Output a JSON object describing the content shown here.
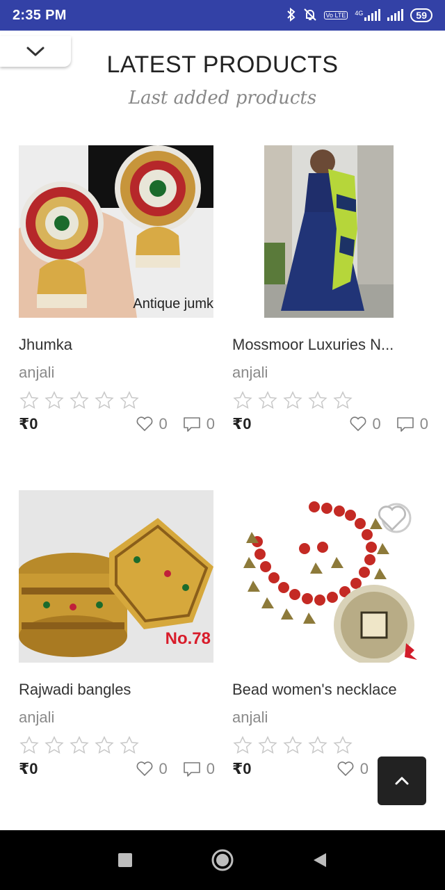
{
  "status_bar": {
    "time": "2:35 PM",
    "network_badge": "Vo LTE",
    "network_type": "4G",
    "battery": "59"
  },
  "header": {
    "title": "LATEST PRODUCTS",
    "subtitle": "Last added products"
  },
  "products": [
    {
      "name": "Jhumka",
      "seller": "anjali",
      "rating": 0,
      "price": "₹0",
      "likes": "0",
      "comments": "0",
      "image_caption": "Antique jumk",
      "image_kind": "gold earrings"
    },
    {
      "name": "Mossmoor Luxuries N...",
      "seller": "anjali",
      "rating": 0,
      "price": "₹0",
      "likes": "0",
      "comments": "0",
      "image_kind": "blue dress with green dupatta"
    },
    {
      "name": "Rajwadi bangles",
      "seller": "anjali",
      "rating": 0,
      "price": "₹0",
      "likes": "0",
      "comments": "0",
      "image_caption": "No.78",
      "image_kind": "gold bangles"
    },
    {
      "name": "Bead women's necklace",
      "seller": "anjali",
      "rating": 0,
      "price": "₹0",
      "likes": "0",
      "image_kind": "red bead necklace"
    }
  ],
  "colors": {
    "status_bar": "#3341a6",
    "nav_bar": "#000000",
    "muted_text": "#8a8a8a",
    "back_to_top": "#222222"
  },
  "icons": {
    "collapse": "chevron-down-icon",
    "star": "star-outline-icon",
    "like": "heart-outline-icon",
    "comment": "comment-outline-icon",
    "back_to_top": "chevron-up-icon",
    "nav_recents": "square-icon",
    "nav_home": "circle-icon",
    "nav_back": "triangle-back-icon"
  }
}
